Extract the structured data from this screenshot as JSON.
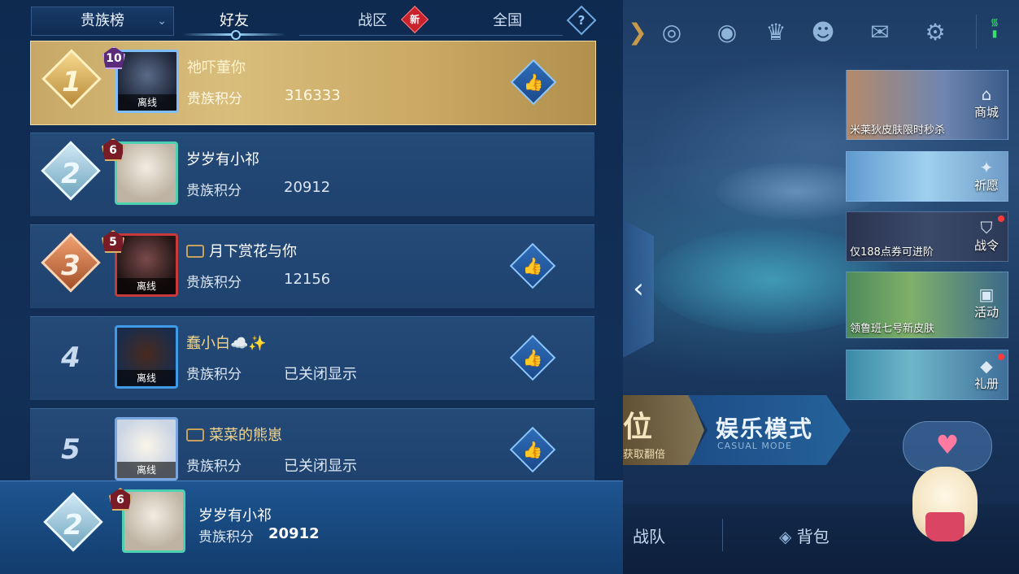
{
  "tabs": {
    "dropdown_label": "贵族榜",
    "friends": "好友",
    "region": "战区",
    "region_badge": "新",
    "national": "全国",
    "help": "?"
  },
  "leaderboard": {
    "score_label": "贵族积分",
    "offline_label": "离线",
    "entries": [
      {
        "rank": "1",
        "name": "祂吓董你",
        "score": "316333",
        "vip": "10",
        "offline": true
      },
      {
        "rank": "2",
        "name": "岁岁有小祁",
        "score": "20912",
        "vip": "6",
        "offline": false
      },
      {
        "rank": "3",
        "name": "月下赏花与你",
        "score": "12156",
        "vip": "5",
        "offline": true
      },
      {
        "rank": "4",
        "name": "蠢小白☁️✨",
        "score": "已关闭显示",
        "vip": "",
        "offline": true
      },
      {
        "rank": "5",
        "name": "菜菜的熊崽",
        "score": "已关闭显示",
        "vip": "",
        "offline": true
      }
    ]
  },
  "my_rank": {
    "rank": "2",
    "vip": "6",
    "name": "岁岁有小祁",
    "score_label": "贵族积分",
    "score": "20912"
  },
  "side_panel": {
    "cards": [
      {
        "caption": "米莱狄皮肤限时秒杀",
        "label": "商城",
        "dot": false
      },
      {
        "caption": "",
        "label": "祈愿",
        "dot": false
      },
      {
        "caption": "仅188点券可进阶",
        "label": "战令",
        "dot": true
      },
      {
        "caption": "领鲁班七号新皮肤",
        "label": "活动",
        "dot": false
      },
      {
        "caption": "",
        "label": "礼册",
        "dot": true
      }
    ],
    "mode_left_big": "位",
    "mode_left_small": "获取翻倍",
    "mode_right_title": "娱乐模式",
    "mode_right_sub": "CASUAL MODE",
    "bottom_team": "战队",
    "bottom_bag": "背包"
  },
  "colors": {
    "gold_row": "#c7a867",
    "row_bg": "#244a78",
    "accent": "#9cd8ff",
    "new_badge": "#c8232c"
  }
}
